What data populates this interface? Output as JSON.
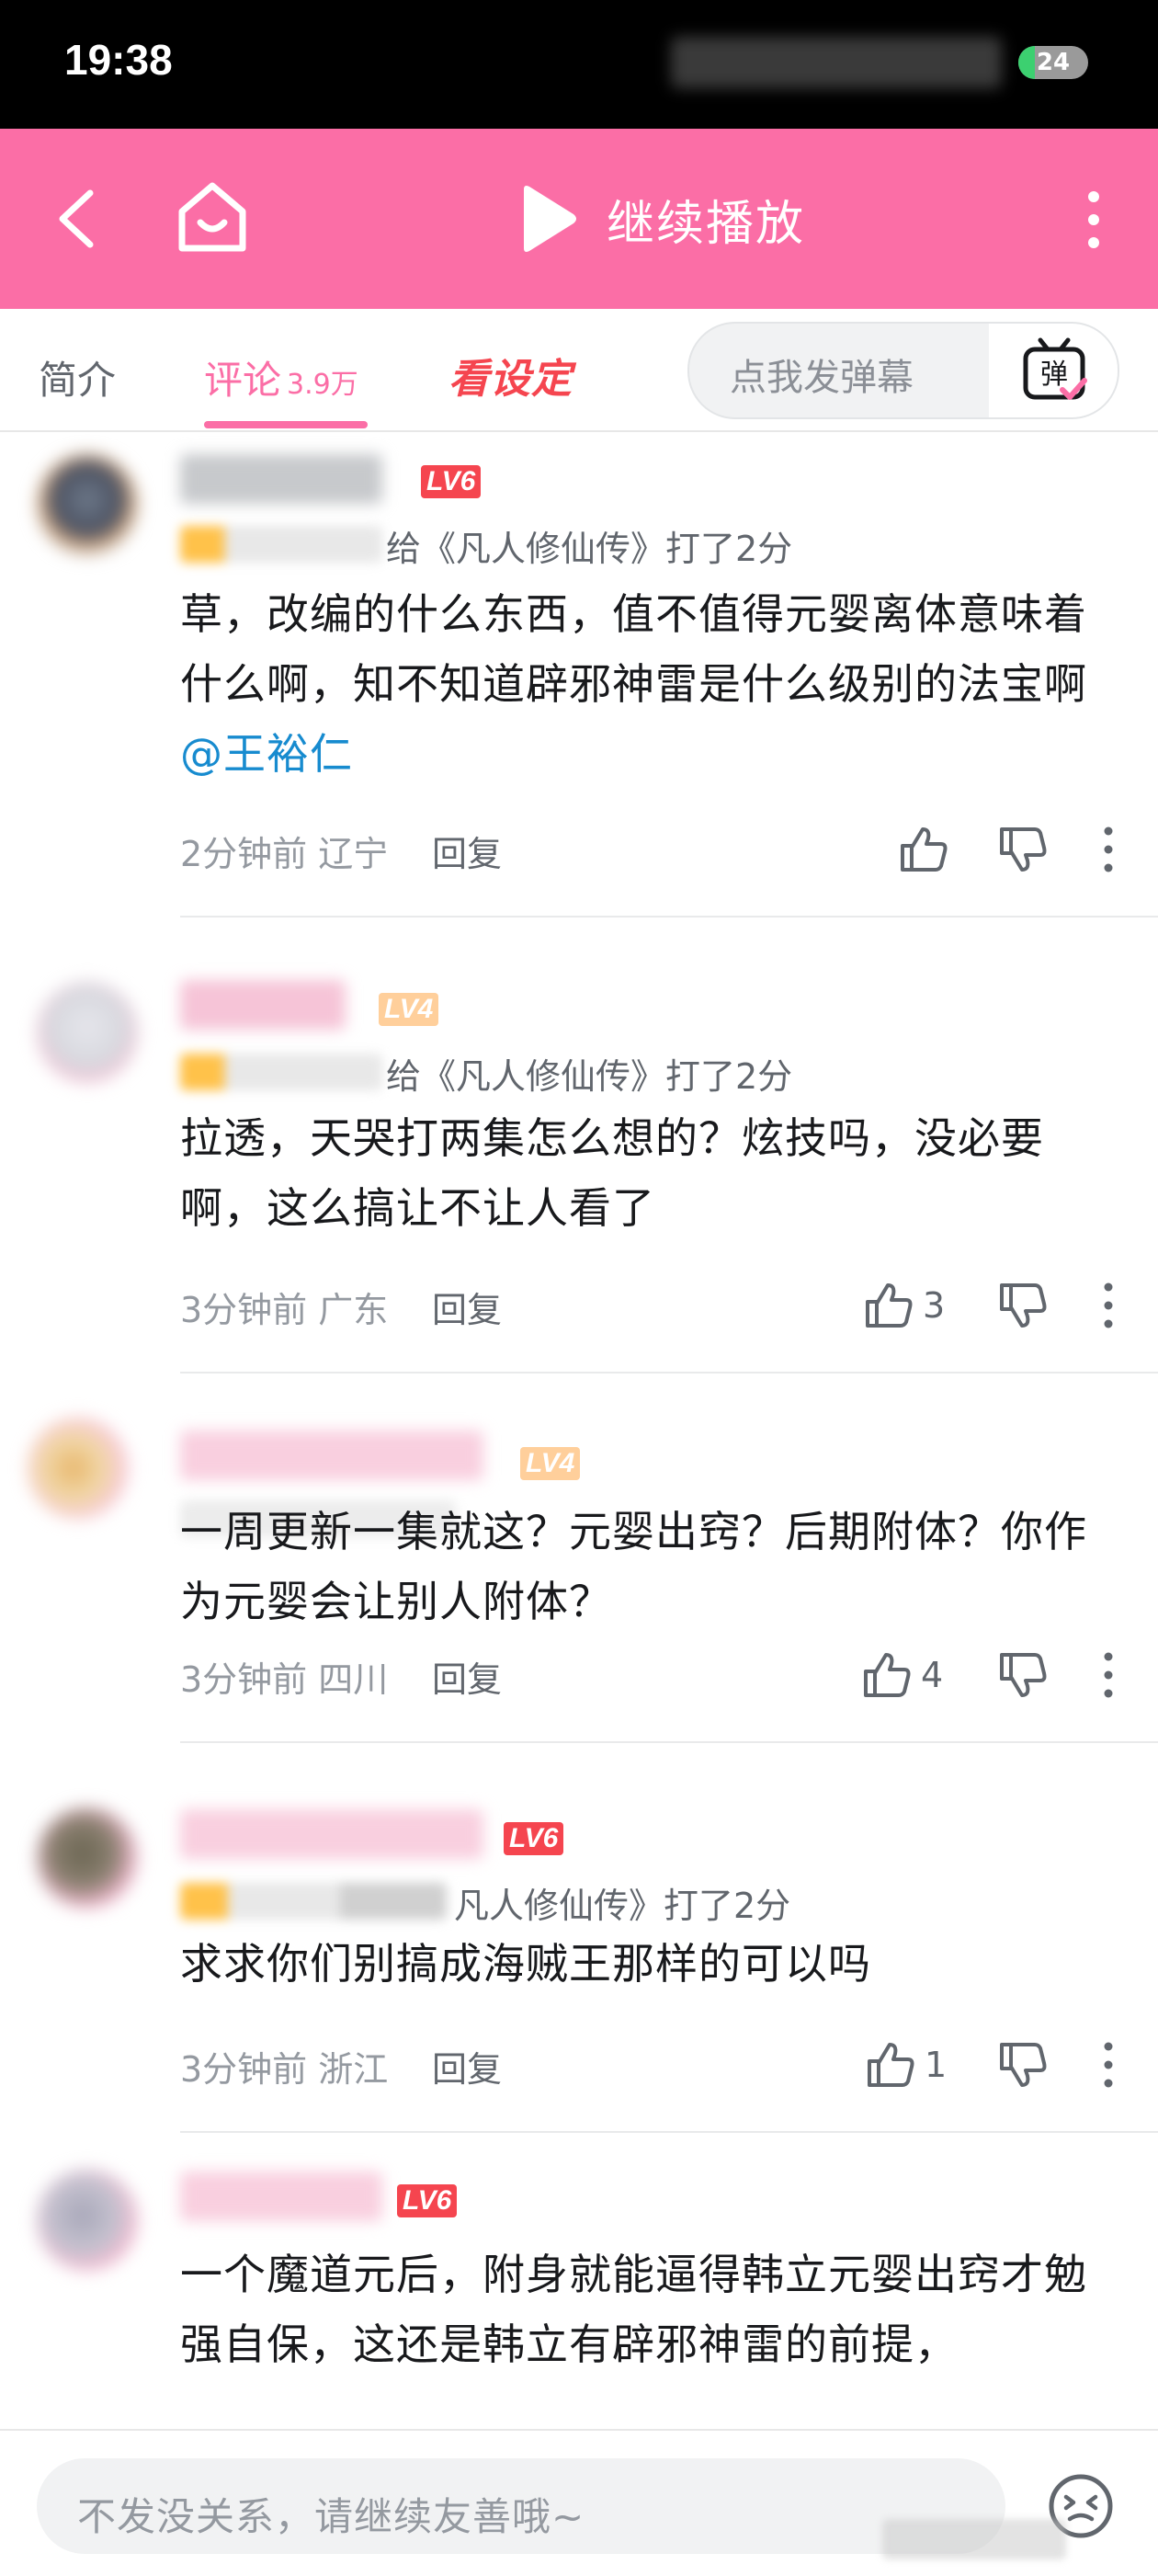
{
  "status_bar": {
    "time": "19:38",
    "battery": "24",
    "battery_level": 0.24
  },
  "header": {
    "continue_label": "继续播放"
  },
  "tabs": {
    "intro": "简介",
    "comments": "评论",
    "comments_count": "3.9万",
    "setting": "看设定",
    "danmaku_placeholder": "点我发弹幕",
    "danmaku_icon_label": "弹"
  },
  "colors": {
    "brand_pink": "#fb6ea6",
    "mention_blue": "#178bcf",
    "lv6_red": "#f5454f",
    "lv4_orange": "#ffb27a"
  },
  "comments": [
    {
      "level": "LV6",
      "rating": "给《凡人修仙传》打了2分",
      "text_before": "草，改编的什么东西，值不值得元婴离体意味着什么啊，知不知道辟邪神雷是什么级别的法宝啊",
      "mention": "@王裕仁",
      "time": "2分钟前",
      "location": "辽宁",
      "reply": "回复",
      "likes": ""
    },
    {
      "level": "LV4",
      "rating": "给《凡人修仙传》打了2分",
      "text_before": "拉透，天哭打两集怎么想的？炫技吗，没必要啊，这么搞让不让人看了",
      "mention": "",
      "time": "3分钟前",
      "location": "广东",
      "reply": "回复",
      "likes": "3"
    },
    {
      "level": "LV4",
      "rating": "",
      "text_before": "一周更新一集就这？元婴出窍？后期附体？你作为元婴会让别人附体？",
      "mention": "",
      "time": "3分钟前",
      "location": "四川",
      "reply": "回复",
      "likes": "4"
    },
    {
      "level": "LV6",
      "rating": "凡人修仙传》打了2分",
      "text_before": "求求你们别搞成海贼王那样的可以吗",
      "mention": "",
      "time": "3分钟前",
      "location": "浙江",
      "reply": "回复",
      "likes": "1"
    },
    {
      "level": "LV6",
      "rating": "",
      "text_before": "一个魔道元后，附身就能逼得韩立元婴出窍才勉强自保，这还是韩立有辟邪神雷的前提，",
      "mention": "",
      "time": "",
      "location": "",
      "reply": "",
      "likes": ""
    }
  ],
  "bottom": {
    "input_placeholder": "不发没关系，请继续友善哦~"
  }
}
